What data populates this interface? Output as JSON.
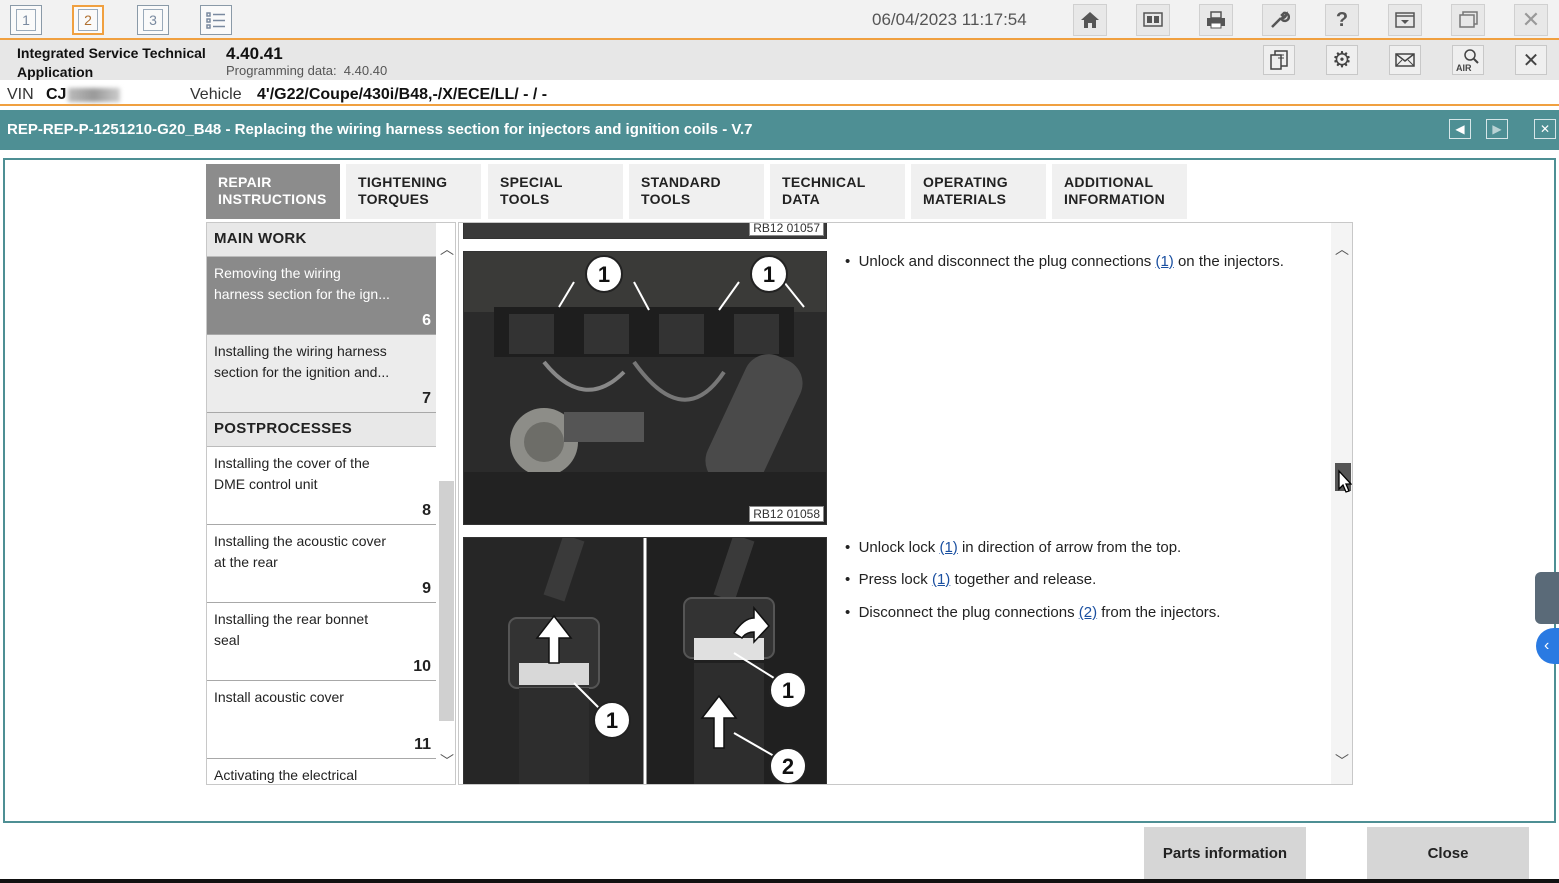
{
  "topbar": {
    "workspaces": [
      "1",
      "2",
      "3"
    ],
    "list_icon": "list-icon",
    "datetime": "06/04/2023 11:17:54",
    "icons": [
      "home-icon",
      "display-icon",
      "print-icon",
      "wrench-icon",
      "help-icon",
      "dropdown-window-icon",
      "window-icon",
      "close-icon"
    ]
  },
  "app": {
    "name_line1": "Integrated Service Technical",
    "name_line2": "Application",
    "version": "4.40.41",
    "programming_label": "Programming data:",
    "programming_value": "4.40.40",
    "icons": [
      "document-icon",
      "gear-icon",
      "mail-icon",
      "air-search-icon",
      "close-icon"
    ]
  },
  "vehicle_bar": {
    "vin_label": "VIN",
    "vin_value": "CJ",
    "vehicle_label": "Vehicle",
    "vehicle_value": "4'/G22/Coupe/430i/B48,-/X/ECE/LL/ - / -"
  },
  "document": {
    "title": "REP-REP-P-1251210-G20_B48 - Replacing the wiring harness section for injectors and ignition coils - V.7"
  },
  "tabs": [
    {
      "line1": "REPAIR",
      "line2": "INSTRUCTIONS"
    },
    {
      "line1": "TIGHTENING",
      "line2": "TORQUES"
    },
    {
      "line1": "SPECIAL TOOLS",
      "line2": ""
    },
    {
      "line1": "STANDARD",
      "line2": "TOOLS"
    },
    {
      "line1": "TECHNICAL",
      "line2": "DATA"
    },
    {
      "line1": "OPERATING",
      "line2": "MATERIALS"
    },
    {
      "line1": "ADDITIONAL",
      "line2": "INFORMATION"
    }
  ],
  "nav": {
    "section_main": "MAIN WORK",
    "section_post": "POSTPROCESSES",
    "items": [
      {
        "line1": "Removing the wiring",
        "line2": "harness section for the ign...",
        "num": "6"
      },
      {
        "line1": "Installing the wiring harness",
        "line2": "section for the ignition and...",
        "num": "7"
      },
      {
        "line1": "Installing the cover of the",
        "line2": "DME control unit",
        "num": "8"
      },
      {
        "line1": "Installing the acoustic cover",
        "line2": "at the rear",
        "num": "9"
      },
      {
        "line1": "Installing the rear bonnet",
        "line2": "seal",
        "num": "10"
      },
      {
        "line1": "Install acoustic cover",
        "line2": "",
        "num": "11"
      },
      {
        "line1": "Activating the electrical",
        "line2": "",
        "num": ""
      }
    ]
  },
  "steps": {
    "img_prev_caption": "RB12 01057",
    "img1_caption": "RB12 01058",
    "callout_1": "1",
    "callout_2": "2",
    "step1_pre": "Unlock and disconnect the plug connections ",
    "step1_ref": "(1)",
    "step1_post": " on the injectors.",
    "step2_pre": "Unlock lock ",
    "step2_ref": "(1)",
    "step2_post": " in direction of arrow from the top.",
    "step3_pre": "Press lock ",
    "step3_ref": "(1)",
    "step3_post": " together and release.",
    "step4_pre": "Disconnect the plug connections ",
    "step4_ref": "(2)",
    "step4_post": " from the injectors."
  },
  "buttons": {
    "parts": "Parts information",
    "close": "Close"
  },
  "colors": {
    "accent": "#f0a040",
    "titlebar": "#4e8f94",
    "link": "#1a4fa0"
  }
}
